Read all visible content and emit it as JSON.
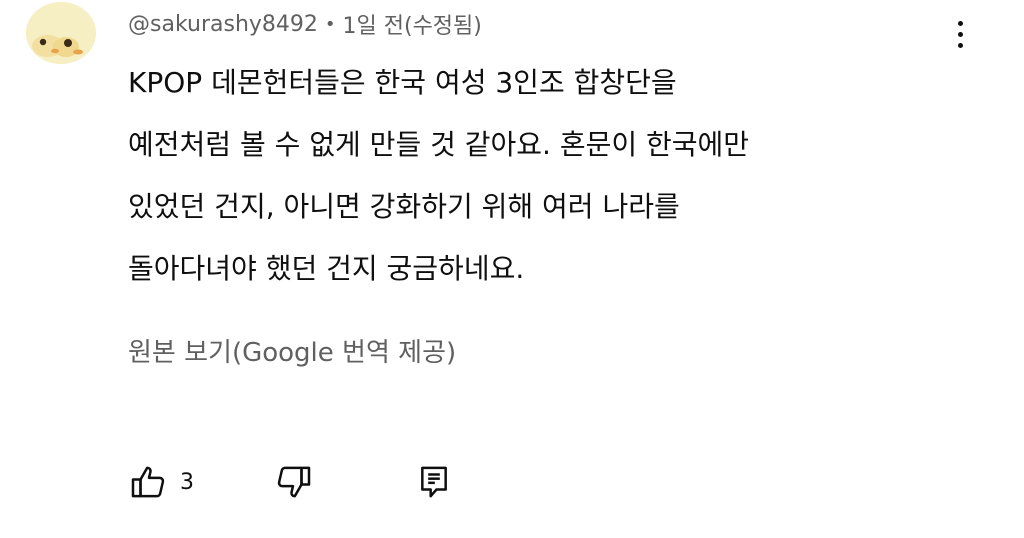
{
  "comment": {
    "author": "@sakurashy8492",
    "separator": "•",
    "time": "1일 전(수정됨)",
    "text_lines": [
      "KPOP 데몬헌터들은 한국 여성 3인조 합창단을",
      "예전처럼 볼 수 없게 만들 것 같아요. 혼문이 한국에만",
      "있었던 건지, 아니면 강화하기 위해 여러 나라를",
      "돌아다녀야 했던 건지 궁금하네요."
    ],
    "see_original_label": "원본 보기(Google 번역 제공)",
    "like_count": "3",
    "icons": {
      "avatar": "avatar",
      "like": "thumbs-up-icon",
      "dislike": "thumbs-down-icon",
      "reply": "reply-icon",
      "menu": "more-vertical-icon"
    }
  },
  "colors": {
    "text_primary": "#0f0f0f",
    "text_secondary": "#606060",
    "avatar_background": "#f6efc4"
  }
}
